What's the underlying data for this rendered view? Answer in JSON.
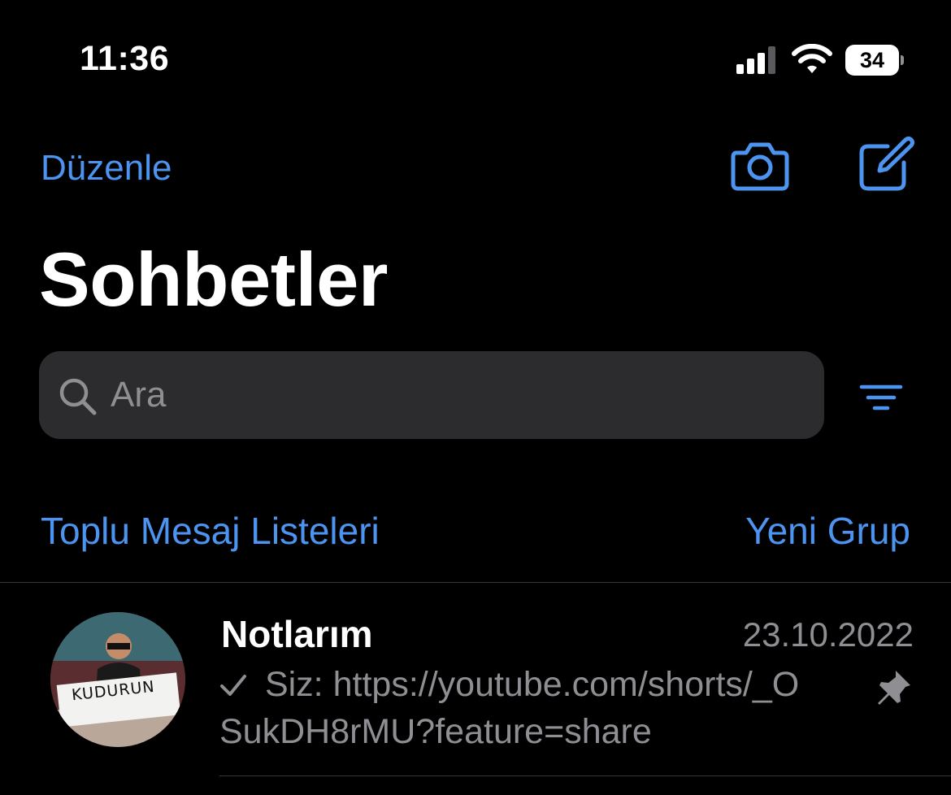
{
  "status_bar": {
    "time": "11:36",
    "battery": "34"
  },
  "header": {
    "edit_label": "Düzenle",
    "title": "Sohbetler"
  },
  "search": {
    "placeholder": "Ara"
  },
  "links": {
    "broadcast": "Toplu Mesaj Listeleri",
    "new_group": "Yeni Grup"
  },
  "chats": [
    {
      "name": "Notlarım",
      "date": "23.10.2022",
      "sender": "Siz:",
      "preview": "https://youtube.com/shorts/_OSukDH8rMU?feature=share",
      "avatar_label": "KUDURUN",
      "pinned": true
    }
  ],
  "colors": {
    "accent": "#4d94f0",
    "background": "#000000",
    "secondary_text": "#8e8e93",
    "search_bg": "#2c2c2e"
  },
  "icons": [
    "signal-icon",
    "wifi-icon",
    "battery-icon",
    "camera-icon",
    "compose-icon",
    "search-icon",
    "filter-icon",
    "pin-icon",
    "check-icon"
  ]
}
